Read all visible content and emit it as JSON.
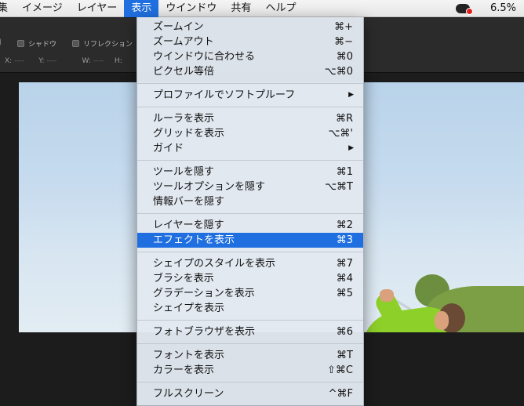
{
  "menubar": {
    "items": [
      "集",
      "イメージ",
      "レイヤー",
      "表示",
      "ウインドウ",
      "共有",
      "ヘルプ"
    ],
    "active_index": 3,
    "zoom": "6.5%"
  },
  "toolbar": {
    "shadow_label": "シャドウ",
    "reflection_label": "リフレクション",
    "coords": [
      {
        "label": "X:",
        "value": "----"
      },
      {
        "label": "Y:",
        "value": "----"
      },
      {
        "label": "W:",
        "value": "----"
      },
      {
        "label": "H:",
        "value": ""
      }
    ]
  },
  "menu": {
    "groups": [
      [
        {
          "label": "ズームイン",
          "shortcut": "⌘+"
        },
        {
          "label": "ズームアウト",
          "shortcut": "⌘−"
        },
        {
          "label": "ウインドウに合わせる",
          "shortcut": "⌘0"
        },
        {
          "label": "ピクセル等倍",
          "shortcut": "⌥⌘0"
        }
      ],
      [
        {
          "label": "プロファイルでソフトプルーフ",
          "shortcut": "",
          "submenu": true
        }
      ],
      [
        {
          "label": "ルーラを表示",
          "shortcut": "⌘R"
        },
        {
          "label": "グリッドを表示",
          "shortcut": "⌥⌘'"
        },
        {
          "label": "ガイド",
          "shortcut": "",
          "submenu": true
        }
      ],
      [
        {
          "label": "ツールを隠す",
          "shortcut": "⌘1"
        },
        {
          "label": "ツールオプションを隠す",
          "shortcut": "⌥⌘T"
        },
        {
          "label": "情報バーを隠す",
          "shortcut": ""
        }
      ],
      [
        {
          "label": "レイヤーを隠す",
          "shortcut": "⌘2"
        },
        {
          "label": "エフェクトを表示",
          "shortcut": "⌘3",
          "highlighted": true
        }
      ],
      [
        {
          "label": "シェイプのスタイルを表示",
          "shortcut": "⌘7"
        },
        {
          "label": "ブラシを表示",
          "shortcut": "⌘4"
        },
        {
          "label": "グラデーションを表示",
          "shortcut": "⌘5"
        },
        {
          "label": "シェイプを表示",
          "shortcut": ""
        }
      ],
      [
        {
          "label": "フォトブラウザを表示",
          "shortcut": "⌘6"
        }
      ],
      [
        {
          "label": "フォントを表示",
          "shortcut": "⌘T"
        },
        {
          "label": "カラーを表示",
          "shortcut": "⇧⌘C"
        }
      ],
      [
        {
          "label": "フルスクリーン",
          "shortcut": "^⌘F"
        }
      ]
    ]
  }
}
